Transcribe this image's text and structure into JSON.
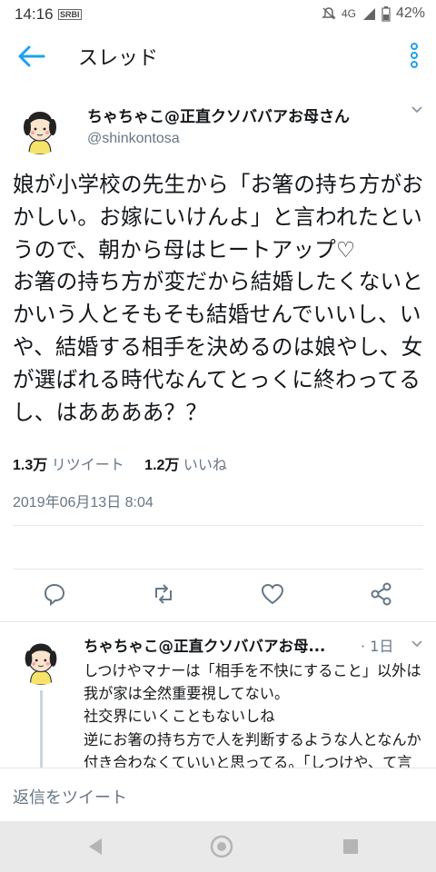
{
  "status_bar": {
    "time": "14:16",
    "carrier": "SRBI",
    "network": "4G",
    "battery": "42%"
  },
  "appbar": {
    "title": "スレッド"
  },
  "tweet": {
    "name": "ちゃちゃこ@正直クソババアお母さん",
    "handle": "@shinkontosa",
    "text": "娘が小学校の先生から「お箸の持ち方がおかしい。お嫁にいけんよ」と言われたというので、朝から母はヒートアップ♡\nお箸の持ち方が変だから結婚したくないとかいう人とそもそも結婚せんでいいし、いや、結婚する相手を決めるのは娘やし、女が選ばれる時代なんてとっくに終わってるし、はああああ？？",
    "date": "2019年06月13日 8:04",
    "retweets_count": "1.3万",
    "retweets_label": "リツイート",
    "likes_count": "1.2万",
    "likes_label": "いいね"
  },
  "reply": {
    "name": "ちゃちゃこ@正直クソババアお母...",
    "time": "· 1日",
    "text": "しつけやマナーは「相手を不快にすること」以外は我が家は全然重要視してない。\n社交界にいくこともないしね\n逆にお箸の持ち方で人を判断するような人となんか付き合わなくていいと思ってる。「しつけや、て言葉、大嫌い。親は「しっけ」で"
  },
  "compose": {
    "placeholder": "返信をツイート"
  },
  "colors": {
    "accent": "#1da1f2",
    "muted": "#657786",
    "divider": "#e1e8ed"
  },
  "icons": [
    "back-arrow-icon",
    "more-vertical-icon",
    "reply-icon",
    "retweet-icon",
    "like-icon",
    "share-icon",
    "nav-back-icon",
    "nav-home-icon",
    "nav-recents-icon"
  ]
}
